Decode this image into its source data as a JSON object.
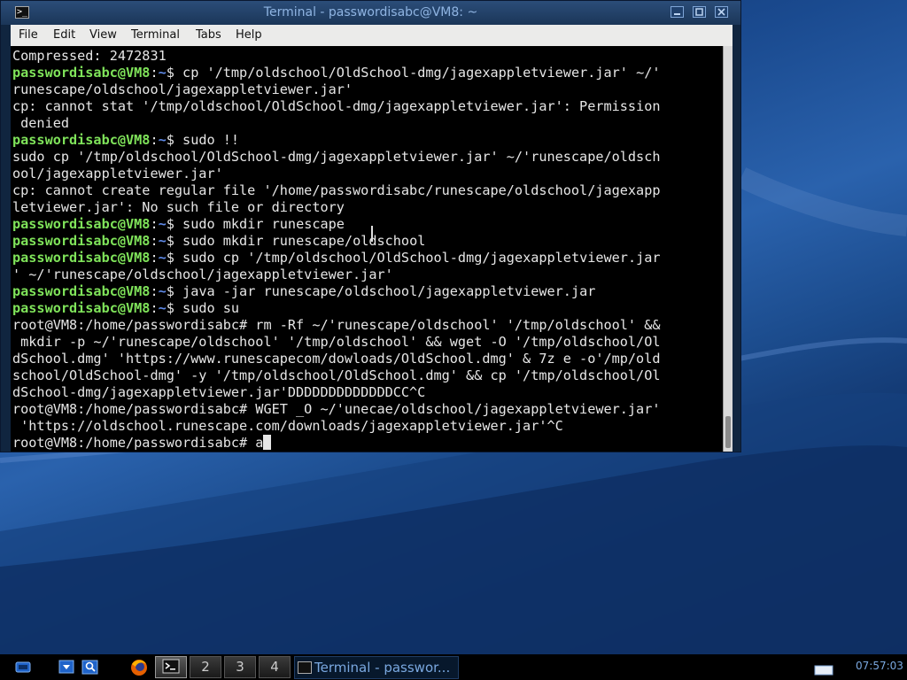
{
  "window": {
    "title": "Terminal - passwordisabc@VM8: ~",
    "menu": [
      "File",
      "Edit",
      "View",
      "Terminal",
      "Tabs",
      "Help"
    ]
  },
  "terminal": {
    "lines": [
      [
        {
          "t": "Compressed: 2472831",
          "c": ""
        }
      ],
      [
        {
          "t": "passwordisabc@VM8",
          "c": "u"
        },
        {
          "t": ":",
          "c": ""
        },
        {
          "t": "~",
          "c": "p"
        },
        {
          "t": "$ cp '/tmp/oldschool/OldSchool-dmg/jagexappletviewer.jar' ~/'",
          "c": ""
        }
      ],
      [
        {
          "t": "runescape/oldschool/jagexappletviewer.jar'",
          "c": ""
        }
      ],
      [
        {
          "t": "cp: cannot stat '/tmp/oldschool/OldSchool-dmg/jagexappletviewer.jar': Permission",
          "c": ""
        }
      ],
      [
        {
          "t": " denied",
          "c": ""
        }
      ],
      [
        {
          "t": "passwordisabc@VM8",
          "c": "u"
        },
        {
          "t": ":",
          "c": ""
        },
        {
          "t": "~",
          "c": "p"
        },
        {
          "t": "$ sudo !!",
          "c": ""
        }
      ],
      [
        {
          "t": "sudo cp '/tmp/oldschool/OldSchool-dmg/jagexappletviewer.jar' ~/'runescape/oldsch",
          "c": ""
        }
      ],
      [
        {
          "t": "ool/jagexappletviewer.jar'",
          "c": ""
        }
      ],
      [
        {
          "t": "cp: cannot create regular file '/home/passwordisabc/runescape/oldschool/jagexapp",
          "c": ""
        }
      ],
      [
        {
          "t": "letviewer.jar': No such file or directory",
          "c": ""
        }
      ],
      [
        {
          "t": "passwordisabc@VM8",
          "c": "u"
        },
        {
          "t": ":",
          "c": ""
        },
        {
          "t": "~",
          "c": "p"
        },
        {
          "t": "$ sudo mkdir runescape",
          "c": ""
        }
      ],
      [
        {
          "t": "passwordisabc@VM8",
          "c": "u"
        },
        {
          "t": ":",
          "c": ""
        },
        {
          "t": "~",
          "c": "p"
        },
        {
          "t": "$ sudo mkdir runescape/oldschool",
          "c": ""
        }
      ],
      [
        {
          "t": "passwordisabc@VM8",
          "c": "u"
        },
        {
          "t": ":",
          "c": ""
        },
        {
          "t": "~",
          "c": "p"
        },
        {
          "t": "$ sudo cp '/tmp/oldschool/OldSchool-dmg/jagexappletviewer.jar",
          "c": ""
        }
      ],
      [
        {
          "t": "' ~/'runescape/oldschool/jagexappletviewer.jar'",
          "c": ""
        }
      ],
      [
        {
          "t": "passwordisabc@VM8",
          "c": "u"
        },
        {
          "t": ":",
          "c": ""
        },
        {
          "t": "~",
          "c": "p"
        },
        {
          "t": "$ java -jar runescape/oldschool/jagexappletviewer.jar",
          "c": ""
        }
      ],
      [
        {
          "t": "passwordisabc@VM8",
          "c": "u"
        },
        {
          "t": ":",
          "c": ""
        },
        {
          "t": "~",
          "c": "p"
        },
        {
          "t": "$ sudo su",
          "c": ""
        }
      ],
      [
        {
          "t": "root@VM8:/home/passwordisabc# rm -Rf ~/'runescape/oldschool' '/tmp/oldschool' &&",
          "c": ""
        }
      ],
      [
        {
          "t": " mkdir -p ~/'runescape/oldschool' '/tmp/oldschool' && wget -O '/tmp/oldschool/Ol",
          "c": ""
        }
      ],
      [
        {
          "t": "dSchool.dmg' 'https://www.runescapecom/dowloads/OldSchool.dmg' & 7z e -o'/mp/old",
          "c": ""
        }
      ],
      [
        {
          "t": "school/OldSchool-dmg' -y '/tmp/oldschool/OldSchool.dmg' && cp '/tmp/oldschool/Ol",
          "c": ""
        }
      ],
      [
        {
          "t": "dSchool-dmg/jagexappletviewer.jar'DDDDDDDDDDDDDCC^C",
          "c": ""
        }
      ],
      [
        {
          "t": "root@VM8:/home/passwordisabc# WGET _O ~/'unecae/oldschool/jagexappletviewer.jar'",
          "c": ""
        }
      ],
      [
        {
          "t": " 'https://oldschool.runescape.com/downloads/jagexappletviewer.jar'^C",
          "c": ""
        }
      ],
      [
        {
          "t": "root@VM8:/home/passwordisabc# a",
          "c": ""
        }
      ]
    ]
  },
  "taskbar": {
    "workspaces": [
      "2",
      "3",
      "4"
    ],
    "task_label": "Terminal - passwor...",
    "clock": "07:57:03"
  }
}
